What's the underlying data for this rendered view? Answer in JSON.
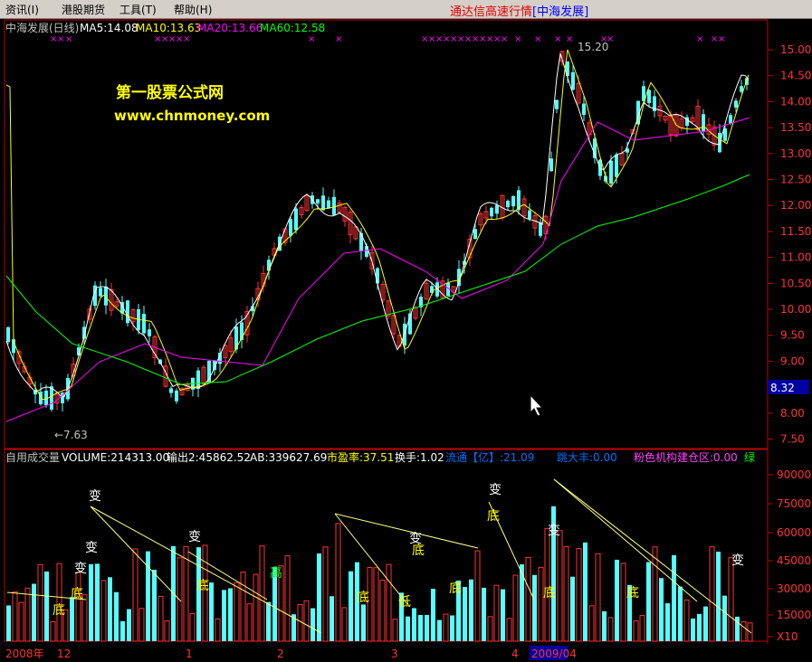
{
  "menu": {
    "items": [
      "资讯(I)",
      "港股期货",
      "工具(T)",
      "帮助(H)"
    ],
    "title_prefix": "通达信高速行情",
    "title_stock": "[中海发展]"
  },
  "main_panel": {
    "title": "中海发展(日线)",
    "ma5": "MA5:14.08",
    "ma10": "MA10:13.63",
    "ma20": "MA20:13.66",
    "ma60": "MA60:12.58",
    "watermark_line1": "第一股票公式网",
    "watermark_line2": "www.chnmoney.com",
    "high_annotation": "15.20",
    "low_annotation": "←7.63",
    "current_price": "8.32",
    "price_ticks": [
      "15.00",
      "14.50",
      "14.00",
      "13.50",
      "13.00",
      "12.50",
      "12.00",
      "11.50",
      "11.00",
      "10.50",
      "10.00",
      "9.50",
      "9.00",
      "8.50",
      "8.00",
      "7.50"
    ],
    "colors": {
      "up": "#ff3232",
      "down": "#54ffff",
      "ma5": "#ffffff",
      "ma10": "#ffff00",
      "ma20": "#ff00ff",
      "ma60": "#00ff00"
    }
  },
  "volume_panel": {
    "items": [
      "自用成交量",
      "VOLUME:214313.00",
      "输出2:45862.52",
      "AB:339627.69",
      "市盈率:37.51",
      "换手:1.02",
      "流通【亿】:21.09",
      "跳大丰:0.00",
      "粉色机构建仓区:0.00",
      "绿"
    ],
    "ticks": [
      "90000",
      "75000",
      "60000",
      "45000",
      "30000",
      "15000",
      "X10"
    ],
    "marks": [
      {
        "t": "变",
        "c": "#ffffff"
      },
      {
        "t": "变",
        "c": "#ffffff"
      },
      {
        "t": "变",
        "c": "#ffffff"
      },
      {
        "t": "变",
        "c": "#ffffff"
      },
      {
        "t": "底",
        "c": "#ffff00"
      },
      {
        "t": "底",
        "c": "#ffff00"
      },
      {
        "t": "底",
        "c": "#ffff00"
      },
      {
        "t": "高",
        "c": "#00ff00"
      },
      {
        "t": "底",
        "c": "#ffff00"
      },
      {
        "t": "低",
        "c": "#ffff00"
      },
      {
        "t": "变",
        "c": "#ffffff"
      },
      {
        "t": "底",
        "c": "#ffff00"
      },
      {
        "t": "底",
        "c": "#ffff00"
      },
      {
        "t": "变",
        "c": "#ffffff"
      },
      {
        "t": "底",
        "c": "#ffff00"
      },
      {
        "t": "变",
        "c": "#ffffff"
      },
      {
        "t": "底",
        "c": "#ffff00"
      },
      {
        "t": "底",
        "c": "#ffff00"
      },
      {
        "t": "变",
        "c": "#ffffff"
      }
    ]
  },
  "date_axis": [
    "2008年",
    "12",
    "1",
    "2",
    "3",
    "4",
    "2009/04"
  ]
}
